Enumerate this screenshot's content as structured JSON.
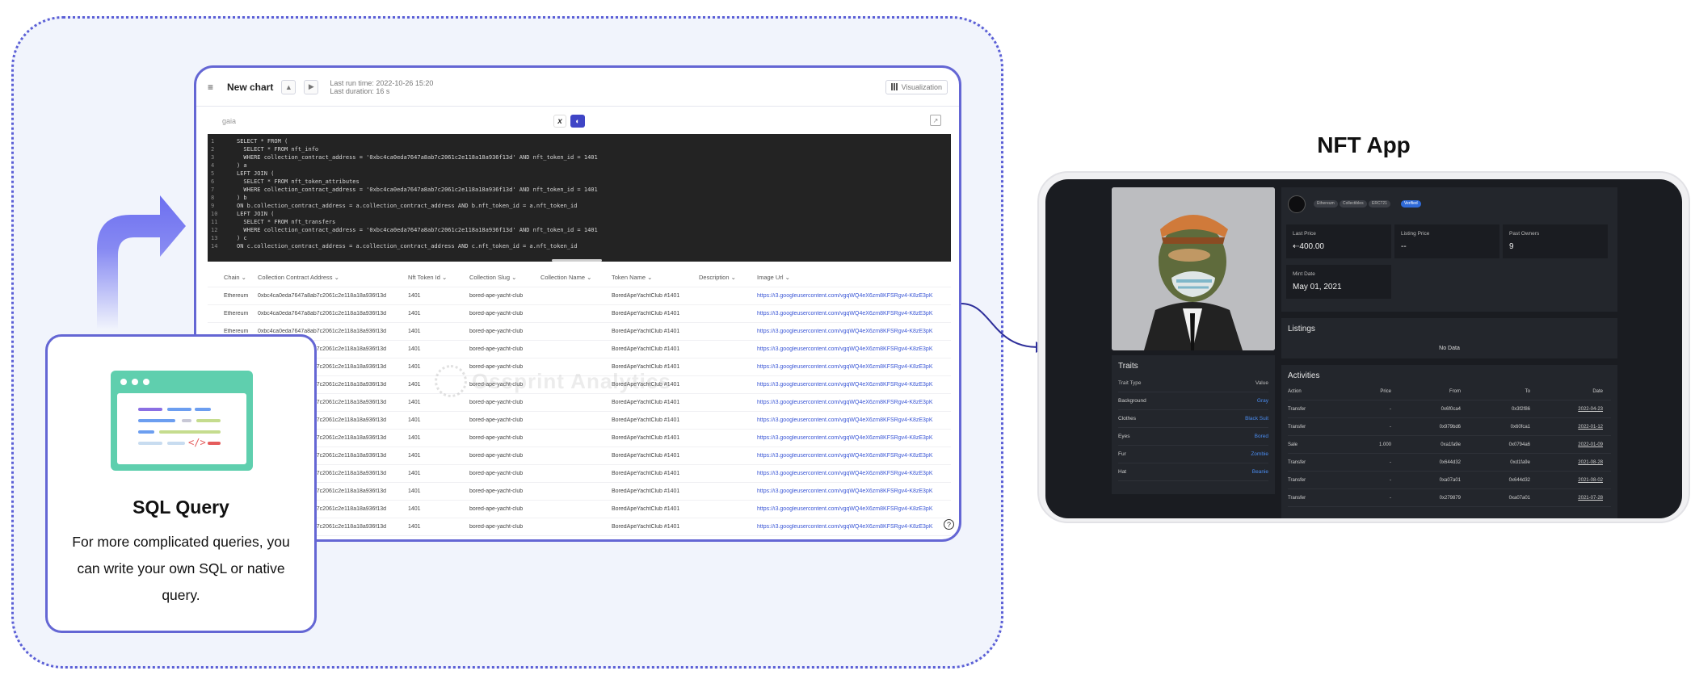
{
  "colors": {
    "accent": "#6466d4",
    "region_bg": "#f1f4fc",
    "link": "#3b57d6",
    "nft_bg": "#1a1c21",
    "nft_panel": "#23262c",
    "nft_link": "#4a8cf0"
  },
  "query_window": {
    "title": "New chart",
    "run_time": "Last run time: 2022-10-26 15:20",
    "duration": "Last duration: 16 s",
    "visualization_label": "Visualization",
    "database": "gaia",
    "code_lines": [
      {
        "n": "1",
        "t": "SELECT * FROM ("
      },
      {
        "n": "2",
        "t": "  SELECT * FROM nft_info"
      },
      {
        "n": "3",
        "t": "  WHERE collection_contract_address = '0xbc4ca0eda7647a8ab7c2061c2e118a18a936f13d' AND nft_token_id = 1401"
      },
      {
        "n": "4",
        "t": ") a"
      },
      {
        "n": "5",
        "t": "LEFT JOIN ("
      },
      {
        "n": "6",
        "t": "  SELECT * FROM nft_token_attributes"
      },
      {
        "n": "7",
        "t": "  WHERE collection_contract_address = '0xbc4ca0eda7647a8ab7c2061c2e118a18a936f13d' AND nft_token_id = 1401"
      },
      {
        "n": "8",
        "t": ") b"
      },
      {
        "n": "9",
        "t": "ON b.collection_contract_address = a.collection_contract_address AND b.nft_token_id = a.nft_token_id"
      },
      {
        "n": "10",
        "t": "LEFT JOIN ("
      },
      {
        "n": "11",
        "t": "  SELECT * FROM nft_transfers"
      },
      {
        "n": "12",
        "t": "  WHERE collection_contract_address = '0xbc4ca0eda7647a8ab7c2061c2e118a18a936f13d' AND nft_token_id = 1401"
      },
      {
        "n": "13",
        "t": ") c"
      },
      {
        "n": "14",
        "t": "ON c.collection_contract_address = a.collection_contract_address AND c.nft_token_id = a.nft_token_id"
      }
    ],
    "columns": [
      "Chain",
      "Collection Contract Address",
      "Nft Token Id",
      "Collection Slug",
      "Collection Name",
      "Token Name",
      "Description",
      "Image Url"
    ],
    "row": {
      "chain": "Ethereum",
      "address": "0xbc4ca0eda7647a8ab7c2061c2e118a18a936f13d",
      "token_id": "1401",
      "slug": "bored-ape-yacht-club",
      "name": "",
      "token_name": "BoredApeYachtClub #1401",
      "description": "",
      "image_url": "https://i3.googleusercontent.com/vgqWQ4eX6zm8KFSRgv4-K8zE3pK"
    },
    "row_count": 14,
    "watermark": "Ossprint Analytics"
  },
  "sql_card": {
    "title": "SQL Query",
    "description": "For more complicated queries, you can write your own SQL or native query."
  },
  "nft_app": {
    "title": "NFT App",
    "pills": [
      "Ethereum",
      "Collectibles",
      "ERC721",
      "Verified"
    ],
    "stats": [
      {
        "label": "Last Price",
        "value": "⇠400.00"
      },
      {
        "label": "Listing Price",
        "value": "--"
      },
      {
        "label": "Past Owners",
        "value": "9"
      }
    ],
    "mint": {
      "label": "Mint Date",
      "value": "May 01, 2021"
    },
    "listings": {
      "title": "Listings",
      "empty": "No Data"
    },
    "traits": {
      "title": "Traits",
      "header": [
        "Trait Type",
        "Value"
      ],
      "rows": [
        [
          "Background",
          "Gray"
        ],
        [
          "Clothes",
          "Black Suit"
        ],
        [
          "Eyes",
          "Bored"
        ],
        [
          "Fur",
          "Zombie"
        ],
        [
          "Hat",
          "Beanie"
        ]
      ]
    },
    "activities": {
      "title": "Activities",
      "header": [
        "Action",
        "Price",
        "From",
        "To",
        "Date"
      ],
      "rows": [
        [
          "Transfer",
          "-",
          "0x6f0ca4",
          "0x3f2f86",
          "2022-04-23"
        ],
        [
          "Transfer",
          "-",
          "0x979bd6",
          "0x60fca1",
          "2022-01-12"
        ],
        [
          "Sale",
          "1.000",
          "0xa1fa9e",
          "0x0794a6",
          "2022-01-09"
        ],
        [
          "Transfer",
          "-",
          "0x644d32",
          "0xd1fa9e",
          "2021-08-28"
        ],
        [
          "Transfer",
          "-",
          "0xa07a01",
          "0x644d32",
          "2021-08-02"
        ],
        [
          "Transfer",
          "-",
          "0x279879",
          "0xa07a01",
          "2021-07-28"
        ]
      ]
    }
  }
}
